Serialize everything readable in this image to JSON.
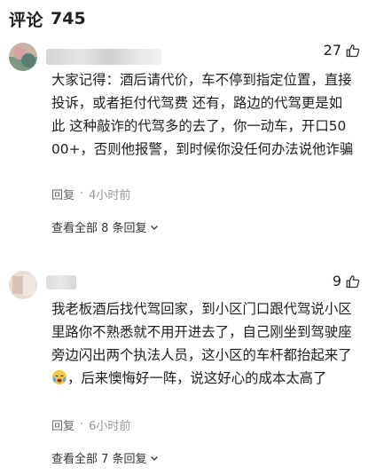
{
  "header": {
    "title": "评论",
    "count": "745"
  },
  "comments": [
    {
      "likes": "27",
      "text": "大家记得：酒后请代价，车不停到指定位置，直接投诉，或者拒付代驾费 还有，路边的代驾更是如此 这种敲诈的代驾多的去了，你一动车，开口5000+，否则他报警，到时候你没任何办法说他诈骗",
      "reply_label": "回复",
      "time": "4小时前",
      "view_replies": "查看全部 8 条回复"
    },
    {
      "likes": "9",
      "text_before_emoji": "我老板酒后找代驾回家，到小区门口跟代驾说小区里路你不熟悉就不用开进去了，自己刚坐到驾驶座旁边闪出两个执法人员，这小区的车杆都抬起来了",
      "emoji_icon": "crying-face-emoji",
      "text_after_emoji": "，后来懊悔好一阵，说这好心的成本太高了",
      "reply_label": "回复",
      "time": "6小时前",
      "view_replies": "查看全部 7 条回复"
    }
  ]
}
